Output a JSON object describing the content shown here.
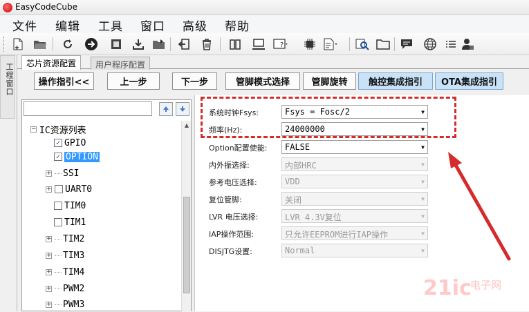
{
  "window": {
    "title": "EasyCodeCube"
  },
  "menu": [
    "文件",
    "编辑",
    "工具",
    "窗口",
    "高级",
    "帮助"
  ],
  "toolbar_icons": [
    "new-file-icon",
    "open-folder-icon",
    "refresh-icon",
    "go-arrow-icon",
    "chip-icon",
    "download-icon",
    "import-icon",
    "exit-icon",
    "delete-icon",
    "book-icon",
    "computer-icon",
    "help-icon",
    "cpu-icon",
    "document-icon",
    "search-icon",
    "folder-icon",
    "message-icon",
    "globe-icon",
    "list-icon",
    "user-icon"
  ],
  "side_tab": {
    "label": "工程窗口"
  },
  "tabs": [
    {
      "label": "芯片资源配置",
      "active": true
    },
    {
      "label": "用户程序配置",
      "active": false
    }
  ],
  "buttons": {
    "guide": "操作指引<<",
    "prev": "上一步",
    "next": "下一步",
    "pin_mode": "管脚模式选择",
    "pin_rotate": "管脚旋转",
    "touch_guide": "触控集成指引",
    "ota_guide": "OTA集成指引"
  },
  "tree": {
    "root": "IC资源列表",
    "items": [
      {
        "label": "GPIO",
        "checked": true,
        "expandable": false
      },
      {
        "label": "OPTION",
        "checked": true,
        "expandable": false,
        "selected": true
      },
      {
        "label": "SSI",
        "expandable": true
      },
      {
        "label": "UART0",
        "checked": false,
        "expandable": true
      },
      {
        "label": "TIM0",
        "checked": false,
        "expandable": false
      },
      {
        "label": "TIM1",
        "checked": false,
        "expandable": false
      },
      {
        "label": "TIM2",
        "expandable": true
      },
      {
        "label": "TIM3",
        "expandable": true
      },
      {
        "label": "TIM4",
        "expandable": true
      },
      {
        "label": "PWM2",
        "expandable": true
      },
      {
        "label": "PWM3",
        "expandable": true
      }
    ]
  },
  "config": {
    "rows": [
      {
        "label": "系统时钟Fsys:",
        "value": "Fsys = Fosc/2",
        "enabled": true
      },
      {
        "label": "频率(Hz):",
        "value": "24000000",
        "enabled": true
      },
      {
        "label": "Option配置使能:",
        "value": "FALSE",
        "enabled": true
      },
      {
        "label": "内外振选择:",
        "value": "内部HRC",
        "enabled": false
      },
      {
        "label": "参考电压选择:",
        "value": "VDD",
        "enabled": false
      },
      {
        "label": "复位管脚:",
        "value": "关闭",
        "enabled": false
      },
      {
        "label": "LVR 电压选择:",
        "value": "LVR 4.3V复位",
        "enabled": false
      },
      {
        "label": "IAP操作范围:",
        "value": "只允许EEPROM进行IAP操作",
        "enabled": false
      },
      {
        "label": "DISJTG设置:",
        "value": "Normal",
        "enabled": false
      }
    ]
  },
  "annotation": {
    "color": "#d52b2b"
  },
  "watermark": {
    "brand": "21ic",
    "cn": "电子网"
  }
}
